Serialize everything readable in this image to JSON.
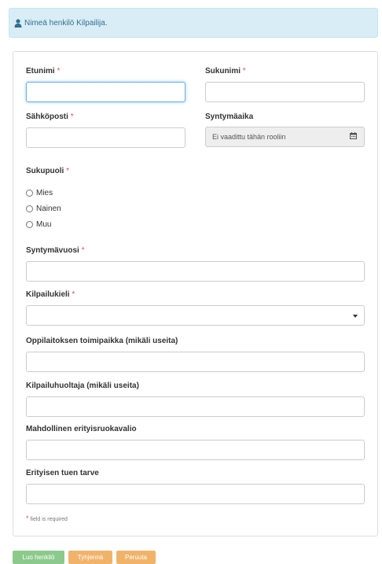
{
  "alert": {
    "text": "Nimeä henkilö Kilpailija.",
    "icon": "user-icon"
  },
  "form": {
    "first_name": {
      "label": "Etunimi",
      "value": ""
    },
    "last_name": {
      "label": "Sukunimi",
      "value": ""
    },
    "email": {
      "label": "Sähköposti",
      "value": ""
    },
    "birth_date": {
      "label": "Syntymäaika",
      "value": "Ei vaadittu tähän rooliin",
      "icon": "calendar-icon"
    },
    "gender": {
      "label": "Sukupuoli",
      "options": [
        "Mies",
        "Nainen",
        "Muu"
      ]
    },
    "birth_year": {
      "label": "Syntymävuosi",
      "value": ""
    },
    "language": {
      "label": "Kilpailukieli",
      "value": ""
    },
    "school_location": {
      "label": "Oppilaitoksen toimipaikka (mikäli useita)",
      "value": ""
    },
    "guardian": {
      "label": "Kilpailuhuoltaja (mikäli useita)",
      "value": ""
    },
    "diet": {
      "label": "Mahdollinen erityisruokavalio",
      "value": ""
    },
    "support": {
      "label": "Erityisen tuen tarve",
      "value": ""
    },
    "required_marker": "*",
    "required_note": "field is required"
  },
  "buttons": {
    "create": "Luo henkilö",
    "clear": "Tyhjennä",
    "cancel": "Peruuta"
  },
  "colors": {
    "alert_bg": "#d9edf7",
    "required": "#d9534f",
    "success": "#8cc98c",
    "warning": "#f1b36a",
    "focus": "#66afe9"
  }
}
